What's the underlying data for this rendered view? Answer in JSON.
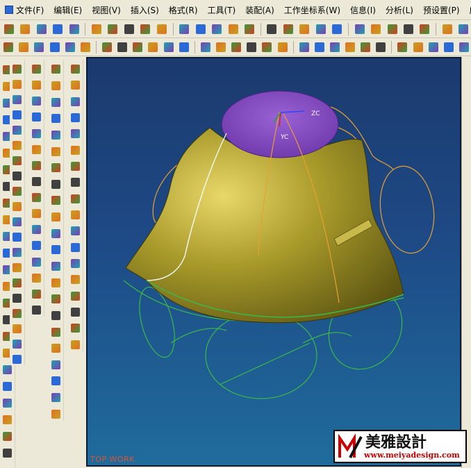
{
  "menubar": {
    "items": [
      {
        "label": "文件(F)",
        "name": "menu-file"
      },
      {
        "label": "编辑(E)",
        "name": "menu-edit"
      },
      {
        "label": "视图(V)",
        "name": "menu-view"
      },
      {
        "label": "插入(S)",
        "name": "menu-insert"
      },
      {
        "label": "格式(R)",
        "name": "menu-format"
      },
      {
        "label": "工具(T)",
        "name": "menu-tools"
      },
      {
        "label": "装配(A)",
        "name": "menu-assembly"
      },
      {
        "label": "工作坐标系(W)",
        "name": "menu-wcs"
      },
      {
        "label": "信息(I)",
        "name": "menu-info"
      },
      {
        "label": "分析(L)",
        "name": "menu-analysis"
      },
      {
        "label": "预设置(P)",
        "name": "menu-preferences"
      },
      {
        "label": "应用",
        "name": "menu-application"
      }
    ]
  },
  "viewport": {
    "view_label": "TOP WORK",
    "axis_labels": {
      "zc": "ZC",
      "yc": "YC"
    },
    "colors": {
      "surface": "#a89a2a",
      "cap": "#8a4fc0",
      "curve_orange": "#e8a030",
      "curve_green": "#3ab84a",
      "curve_white": "#ffffff"
    }
  },
  "watermark": {
    "title": "美雅設計",
    "url": "www.meiyadesign.com"
  }
}
